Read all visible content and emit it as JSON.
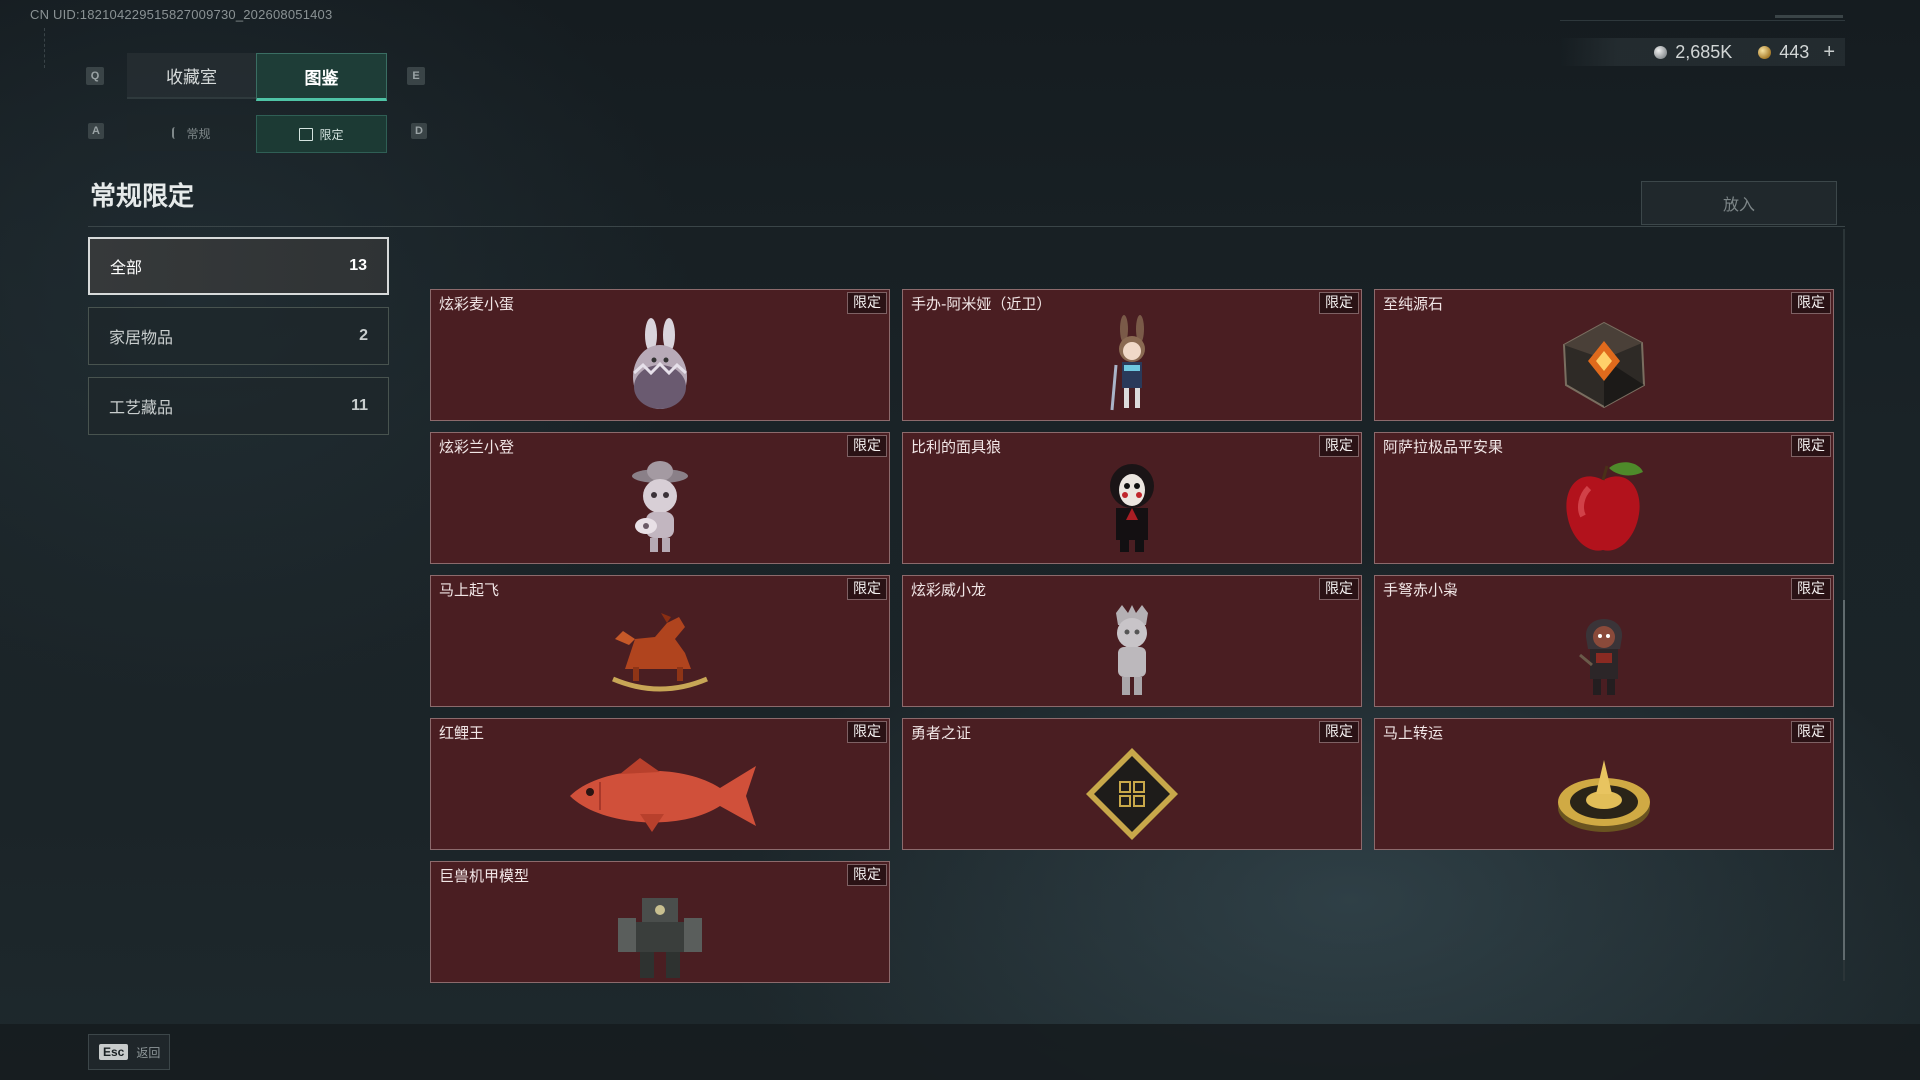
{
  "uid_text": "CN UID:18210422951582700973​0_202608051403",
  "keys": {
    "q": "Q",
    "e": "E",
    "a": "A",
    "d": "D"
  },
  "tabs": [
    {
      "label": "收藏室",
      "active": false
    },
    {
      "label": "图鉴",
      "active": true
    }
  ],
  "subtabs": [
    {
      "label": "常规",
      "active": false,
      "icon": "figure-icon"
    },
    {
      "label": "限定",
      "active": true,
      "icon": "picture-icon"
    }
  ],
  "currency": {
    "silver": "2,685K",
    "gold": "443"
  },
  "section_title": "常规限定",
  "place_button": "放入",
  "categories": [
    {
      "label": "全部",
      "count": "13",
      "active": true
    },
    {
      "label": "家居物品",
      "count": "2",
      "active": false
    },
    {
      "label": "工艺藏品",
      "count": "11",
      "active": false
    }
  ],
  "items": [
    {
      "name": "炫彩麦小蛋",
      "tag": "限定",
      "icon": "bunny-egg-icon"
    },
    {
      "name": "手办-阿米娅（近卫）",
      "tag": "限定",
      "icon": "amiya-figure-icon"
    },
    {
      "name": "至纯源石",
      "tag": "限定",
      "icon": "originium-icon"
    },
    {
      "name": "炫彩兰小登",
      "tag": "限定",
      "icon": "sombrero-doll-icon"
    },
    {
      "name": "比利的面具狼",
      "tag": "限定",
      "icon": "masked-doll-icon"
    },
    {
      "name": "阿萨拉极品平安果",
      "tag": "限定",
      "icon": "apple-icon"
    },
    {
      "name": "马上起飞",
      "tag": "限定",
      "icon": "rocking-horse-icon"
    },
    {
      "name": "炫彩威小龙",
      "tag": "限定",
      "icon": "dragon-doll-icon"
    },
    {
      "name": "手弩赤小枭",
      "tag": "限定",
      "icon": "hooded-doll-icon"
    },
    {
      "name": "红鲤王",
      "tag": "限定",
      "icon": "koi-fish-icon"
    },
    {
      "name": "勇者之证",
      "tag": "限定",
      "icon": "badge-card-icon"
    },
    {
      "name": "马上转运",
      "tag": "限定",
      "icon": "golden-wheel-icon"
    },
    {
      "name": "巨兽机甲模型",
      "tag": "限定",
      "icon": "mech-model-icon"
    }
  ],
  "esc": {
    "key": "Esc",
    "label": "返回"
  }
}
